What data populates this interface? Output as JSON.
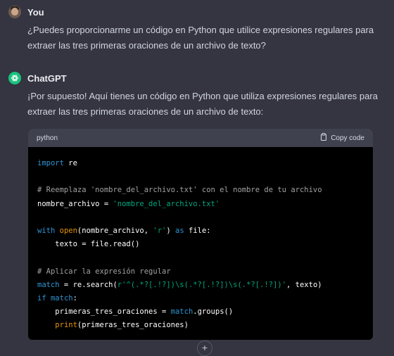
{
  "user": {
    "name": "You",
    "message": "¿Puedes proporcionarme un código en Python que utilice expresiones regulares para extraer las tres primeras oraciones de un archivo de texto?"
  },
  "assistant": {
    "name": "ChatGPT",
    "message": "¡Por supuesto! Aquí tienes un código en Python que utiliza expresiones regulares para extraer las tres primeras oraciones de un archivo de texto:",
    "code": {
      "language": "python",
      "copy_label": "Copy code",
      "lines": {
        "l1_kw": "import",
        "l1_rest": " re",
        "l3": "# Reemplaza 'nombre_del_archivo.txt' con el nombre de tu archivo",
        "l4_a": "nombre_archivo = ",
        "l4_str": "'nombre_del_archivo.txt'",
        "l6_kw": "with",
        "l6_fn": "open",
        "l6_a": "(nombre_archivo, ",
        "l6_str": "'r'",
        "l6_b": ") ",
        "l6_as": "as",
        "l6_c": " file:",
        "l7": "    texto = file.read()",
        "l9": "# Aplicar la expresión regular",
        "l10_kw": "match",
        "l10_a": " = re.search(",
        "l10_str": "r'^(.*?[.!?])\\s(.*?[.!?])\\s(.*?[.!?])'",
        "l10_b": ", texto)",
        "l11_kw": "if",
        "l11_a": " ",
        "l11_kw2": "match",
        "l11_b": ":",
        "l12_a": "    primeras_tres_oraciones = ",
        "l12_kw": "match",
        "l12_b": ".groups()",
        "l13_pad": "    ",
        "l13_fn": "print",
        "l13_a": "(primeras_tres_oraciones)"
      }
    }
  },
  "icons": {
    "user_avatar": "user-photo-avatar",
    "bot_avatar": "openai-logo-icon",
    "copy": "clipboard-icon",
    "scroll": "plus-icon"
  },
  "colors": {
    "background": "#343541",
    "bot_avatar": "#19c37d",
    "keyword": "#2e95d3",
    "string": "#00a67d",
    "comment": "#a1a1a1",
    "builtin": "#e9950c"
  }
}
